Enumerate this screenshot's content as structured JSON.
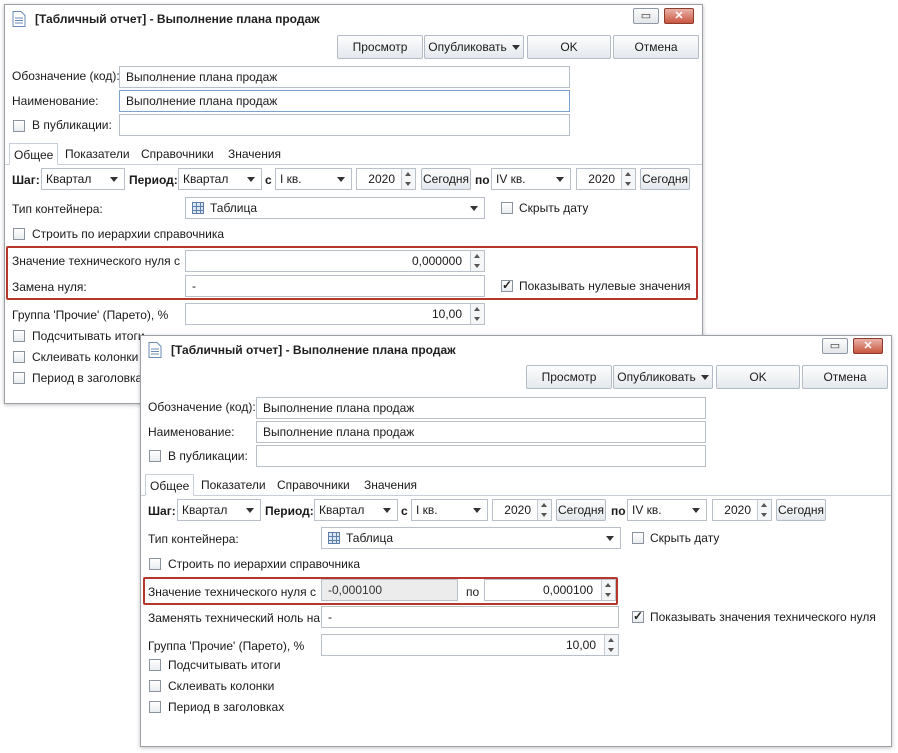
{
  "window1": {
    "title": "[Табличный отчет] - Выполнение плана продаж",
    "toolbar": {
      "preview": "Просмотр",
      "publish": "Опубликовать",
      "ok": "OK",
      "cancel": "Отмена"
    },
    "code_label": "Обозначение (код):",
    "code_value": "Выполнение плана продаж",
    "name_label": "Наименование:",
    "name_value": "Выполнение плана продаж",
    "publish_label": "В публикации:",
    "tabs": [
      "Общее",
      "Показатели",
      "Справочники",
      "Значения"
    ],
    "step_label": "Шаг:",
    "step_value": "Квартал",
    "period_label": "Период:",
    "period_value": "Квартал",
    "from_label": "с",
    "from_quarter": "I кв.",
    "from_year": "2020",
    "today": "Сегодня",
    "to_label": "по",
    "to_quarter": "IV кв.",
    "to_year": "2020",
    "container_label": "Тип контейнера:",
    "container_value": "Таблица",
    "hide_date": "Скрыть дату",
    "hierarchy": "Строить по иерархии справочника",
    "tech_zero_label": "Значение технического нуля с",
    "tech_zero_value": "0,000000",
    "zero_replace_label": "Замена нуля:",
    "zero_replace_value": "-",
    "show_zero": "Показывать нулевые значения",
    "other_group_label": "Группа 'Прочие' (Парето), %",
    "other_group_value": "10,00",
    "totals": "Подсчитывать итоги",
    "merge": "Склеивать колонки",
    "period_headers": "Период в заголовках"
  },
  "window2": {
    "title": "[Табличный отчет] - Выполнение плана продаж",
    "toolbar": {
      "preview": "Просмотр",
      "publish": "Опубликовать",
      "ok": "OK",
      "cancel": "Отмена"
    },
    "code_label": "Обозначение (код):",
    "code_value": "Выполнение плана продаж",
    "name_label": "Наименование:",
    "name_value": "Выполнение плана продаж",
    "publish_label": "В публикации:",
    "tabs": [
      "Общее",
      "Показатели",
      "Справочники",
      "Значения"
    ],
    "step_label": "Шаг:",
    "step_value": "Квартал",
    "period_label": "Период:",
    "period_value": "Квартал",
    "from_label": "с",
    "from_quarter": "I кв.",
    "from_year": "2020",
    "today": "Сегодня",
    "to_label": "по",
    "to_quarter": "IV кв.",
    "to_year": "2020",
    "container_label": "Тип контейнера:",
    "container_value": "Таблица",
    "hide_date": "Скрыть дату",
    "hierarchy": "Строить по иерархии справочника",
    "tech_zero_label": "Значение технического нуля с",
    "tech_zero_from": "-0,000100",
    "tech_zero_to_label": "по",
    "tech_zero_to": "0,000100",
    "replace_label": "Заменять технический ноль на:",
    "replace_value": "-",
    "show_tech_zero": "Показывать значения технического нуля",
    "other_group_label": "Группа 'Прочие' (Парето), %",
    "other_group_value": "10,00",
    "totals": "Подсчитывать итоги",
    "merge": "Склеивать колонки",
    "period_headers": "Период в заголовках"
  },
  "colors": {
    "highlight": "#b5372c",
    "accent_border": "#7da2ce"
  }
}
